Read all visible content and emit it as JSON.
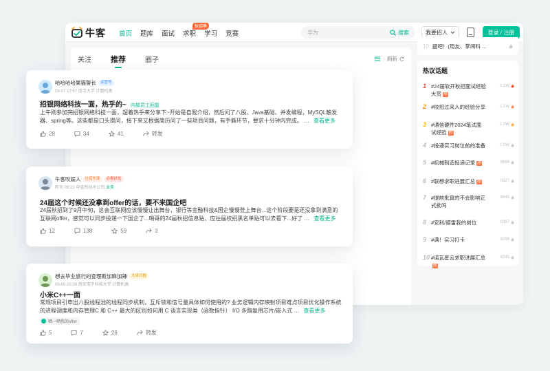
{
  "header": {
    "logo_text": "牛客",
    "nav": [
      {
        "label": "首页",
        "active": true
      },
      {
        "label": "题库"
      },
      {
        "label": "面试"
      },
      {
        "label": "求职",
        "badge": "秋招季"
      },
      {
        "label": "学习"
      },
      {
        "label": "竞赛"
      }
    ],
    "search_placeholder": "华为",
    "search_button": "搜索",
    "hire_label": "我要招人",
    "login_label": "登录 / 注册"
  },
  "feed": {
    "tabs": [
      {
        "label": "关注"
      },
      {
        "label": "推荐",
        "active": true
      },
      {
        "label": "圈子"
      }
    ],
    "refresh_label": "刷新"
  },
  "sidebar": {
    "top_item": {
      "num": "10",
      "text": "题吧！(用友、掌阅科 ..."
    },
    "topics_title": "热议话题",
    "topics": [
      {
        "rank": "1",
        "text": "#24届软开秋招面试经验大赏",
        "tag": "热",
        "heat": "1.1W"
      },
      {
        "rank": "2",
        "text": "#校招过来人的经验分享",
        "tag": "",
        "heat": "1.1W"
      },
      {
        "rank": "3",
        "text": "#通信硬件2024笔试面试经验",
        "tag": "热",
        "heat": "1.0W"
      },
      {
        "rank": "4",
        "text": "#投递实习岗位前的准备",
        "tag": "",
        "heat": "1.0W"
      },
      {
        "rank": "5",
        "text": "#机械制造投递记录",
        "tag": "热",
        "heat": "9669"
      },
      {
        "rank": "6",
        "text": "#联想求职进展汇总",
        "tag": "热",
        "heat": "9327"
      },
      {
        "rank": "7",
        "text": "#提前批真的不会影响正式批吗",
        "tag": "",
        "heat": "8645"
      },
      {
        "rank": "8",
        "text": "#安利/避雷我的岗位",
        "tag": "",
        "heat": "8397"
      },
      {
        "rank": "9",
        "text": "#满！实习打卡",
        "tag": "",
        "heat": "8298"
      },
      {
        "rank": "10",
        "text": "#诺瓦星云求职进展汇总",
        "tag": "热",
        "heat": "8245"
      }
    ]
  },
  "posts": [
    {
      "author": "哈哈哈哈果猫警长",
      "badges": [
        {
          "text": "运营号",
          "style": "blue"
        }
      ],
      "meta": "09-07 17:57  南京大学 计算机类",
      "meta_green": "",
      "title": "招银网络科技一面，热乎的~",
      "title_tag": "内部员工回复",
      "body": "上午刚参加完招银网络科技一面，超着热乎来分享下~开始是自我介绍，然后问了八股、Java基础、并发编程，MySQL触发器、spring等。这些都是口头提问，接下来又根据简历问了一些项目问题，有手撕环节，要求十分钟内完成。 …",
      "more": "查看更多",
      "chip": "",
      "actions": {
        "likes": "28",
        "comments": "34",
        "stars": "41",
        "share": "转发"
      }
    },
    {
      "author": "牛客吹娱人",
      "badges": [
        {
          "text": "社招先锋",
          "style": "orange"
        },
        {
          "text": "必看扶贫",
          "style": "red"
        }
      ],
      "meta": "昨天 09:21  中金所技术公司",
      "meta_green": "业务",
      "title": "24届这个时候还没拿到offer的话，要不来国企吧",
      "title_tag": "",
      "body": "24届秋招到了9月中旬，这会互联网应该慢慢让出舞台，银行等金融科技&国企慢慢登上舞台...这个阶段要是还没拿到满意的互联网offer，感觉可以同步投递一下国企了...哨哥的24届秋招信息贴、应往届校招黑名单贴可以去看下...好了 …",
      "more": "查看更多",
      "chip": "",
      "actions": {
        "likes": "12",
        "comments": "138",
        "stars": "59",
        "share": "3"
      }
    },
    {
      "author": "想去毕业旅行的查理斯加麻加辣",
      "badges": [
        {
          "text": "大佬日报",
          "style": "gold"
        }
      ],
      "meta": "09-09 20:29  西安电子科技大学 计算机类",
      "meta_green": "",
      "title": "小米C++一面",
      "title_tag": "",
      "body": "常规项目引申出八股线程池的线程同步机制，互斥锁和信号量具体如何使用的? 业务逻辑内存映射项目难点项目优化操作系统的进程调度和内存管理C 和 C++ 最大的区别如何用 C 语言实现类（函数指针） I/O 多路复用芯片/嵌入式 …",
      "more": "查看更多",
      "chip": "晒一晒我的offer",
      "actions": {
        "likes": "5",
        "comments": "7",
        "stars": "28",
        "share": "转发"
      }
    }
  ],
  "colors": {
    "brand": "#00b88d",
    "hot": "#ff7a45",
    "rank1": "#ff4b2b",
    "rank2": "#ff8a00",
    "rank3": "#ffb800"
  }
}
